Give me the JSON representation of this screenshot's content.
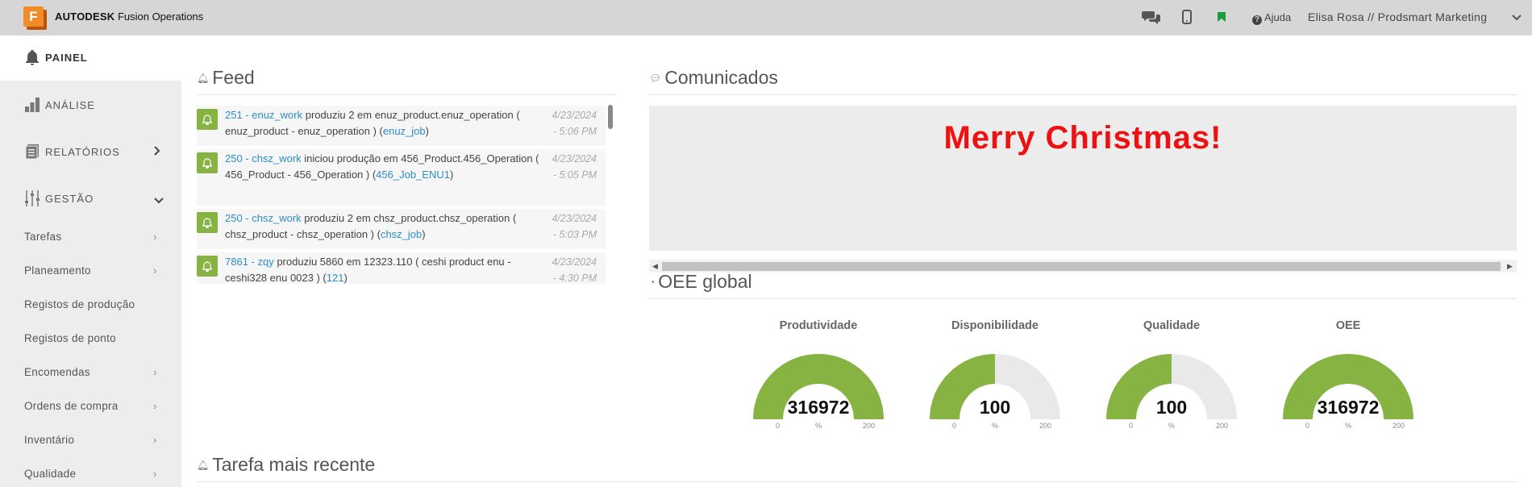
{
  "topbar": {
    "logo_letter": "F",
    "brand_bold": "AUTODESK",
    "brand_rest": "Fusion Operations",
    "help_label": "Ajuda",
    "user_label": "Elisa Rosa // Prodsmart Marketing",
    "icons": [
      "chat-icon",
      "mobile-icon",
      "bookmark-icon",
      "help-icon",
      "chevron-down-icon"
    ]
  },
  "sidebar": {
    "main": [
      {
        "label": "PAINEL",
        "icon": "bell-icon"
      },
      {
        "label": "ANÁLISE",
        "icon": "bar-chart-icon"
      },
      {
        "label": "RELATÓRIOS",
        "icon": "report-icon"
      },
      {
        "label": "GESTÃO",
        "icon": "sliders-icon"
      }
    ],
    "sub": [
      {
        "label": "Tarefas",
        "chevron": true
      },
      {
        "label": "Planeamento",
        "chevron": true
      },
      {
        "label": "Registos de produção",
        "chevron": false
      },
      {
        "label": "Registos de ponto",
        "chevron": false
      },
      {
        "label": "Encomendas",
        "chevron": true
      },
      {
        "label": "Ordens de compra",
        "chevron": true
      },
      {
        "label": "Inventário",
        "chevron": true
      },
      {
        "label": "Qualidade",
        "chevron": true
      }
    ]
  },
  "feed": {
    "title": "Feed",
    "items": [
      {
        "link1": "251 - enuz_work",
        "text": " produziu 2 em enuz_product.enuz_operation ( enuz_product - enuz_operation ) (",
        "link2": "enuz_job",
        "end": ")",
        "date": "4/23/2024",
        "time": "- 5:06 PM"
      },
      {
        "link1": "250 - chsz_work",
        "text": " iniciou produção em 456_Product.456_Operation ( 456_Product - 456_Operation ) (",
        "link2": "456_Job_ENU1",
        "end": ")",
        "date": "4/23/2024",
        "time": "- 5:05 PM"
      },
      {
        "link1": "250 - chsz_work",
        "text": " produziu 2 em chsz_product.chsz_operation ( chsz_product - chsz_operation ) (",
        "link2": "chsz_job",
        "end": ")",
        "date": "4/23/2024",
        "time": "- 5:03 PM"
      },
      {
        "link1": "7861 - zqy",
        "text": " produziu 5860 em 12323.110 ( ceshi product enu - ceshi328 enu 0023 ) (",
        "link2": "121",
        "end": ")",
        "date": "4/23/2024",
        "time": "- 4:30 PM"
      }
    ]
  },
  "comunicados": {
    "title": "Comunicados",
    "message": "Merry Christmas!",
    "message_color": "#ee1111"
  },
  "oee": {
    "title": "OEE global",
    "gauges": [
      {
        "label": "Produtividade",
        "value": "316972",
        "fraction": 1.0,
        "min": "0",
        "max": "200",
        "unit": "%"
      },
      {
        "label": "Disponibilidade",
        "value": "100",
        "fraction": 0.5,
        "min": "0",
        "max": "200",
        "unit": "%"
      },
      {
        "label": "Qualidade",
        "value": "100",
        "fraction": 0.5,
        "min": "0",
        "max": "200",
        "unit": "%"
      },
      {
        "label": "OEE",
        "value": "316972",
        "fraction": 1.0,
        "min": "0",
        "max": "200",
        "unit": "%"
      }
    ],
    "fill_color": "#86b341",
    "track_color": "#e9e9e9"
  },
  "tarefa": {
    "title": "Tarefa mais recente"
  }
}
